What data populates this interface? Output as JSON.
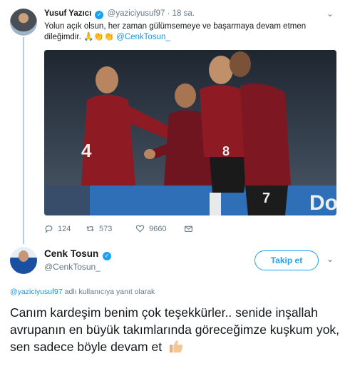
{
  "tweet1": {
    "author_name": "Yusuf Yazıcı",
    "handle": "@yaziciyusuf97",
    "separator": "·",
    "time": "18 sa.",
    "text": "Yolun açık olsun, her zaman gülümsemeye ve başarmaya devam etmen dileğimdir.",
    "emoji_text": "🙏👏👏",
    "mention": "@CenkTosun_",
    "photo_jersey_numbers": [
      "4",
      "8",
      "7"
    ],
    "photo_ad_text": "Doo",
    "actions": {
      "replies": "124",
      "retweets": "573",
      "likes": "9660"
    }
  },
  "tweet2": {
    "author_name": "Cenk Tosun",
    "handle": "@CenkTosun_",
    "follow_label": "Takip et",
    "reply_to_handle": "@yaziciyusuf97",
    "reply_to_suffix": "adlı kullanıcıya yanıt olarak",
    "text": "Canım kardeşim benim çok teşekkürler.. senide inşallah avrupanın en büyük takımlarında göreceğimze kuşkum yok, sen sadece böyle devam et"
  },
  "icons": {
    "reply": "reply-icon",
    "retweet": "retweet-icon",
    "like": "heart-icon",
    "dm": "envelope-icon",
    "verified": "verified-badge-icon",
    "menu": "chevron-down-icon",
    "emoji": "thumbs-up-icon"
  },
  "colors": {
    "accent": "#1da1f2",
    "mention": "#1b95e0",
    "muted": "#657786",
    "thread_line": "#a9d3f2",
    "jersey_red": "#8e1b24"
  }
}
